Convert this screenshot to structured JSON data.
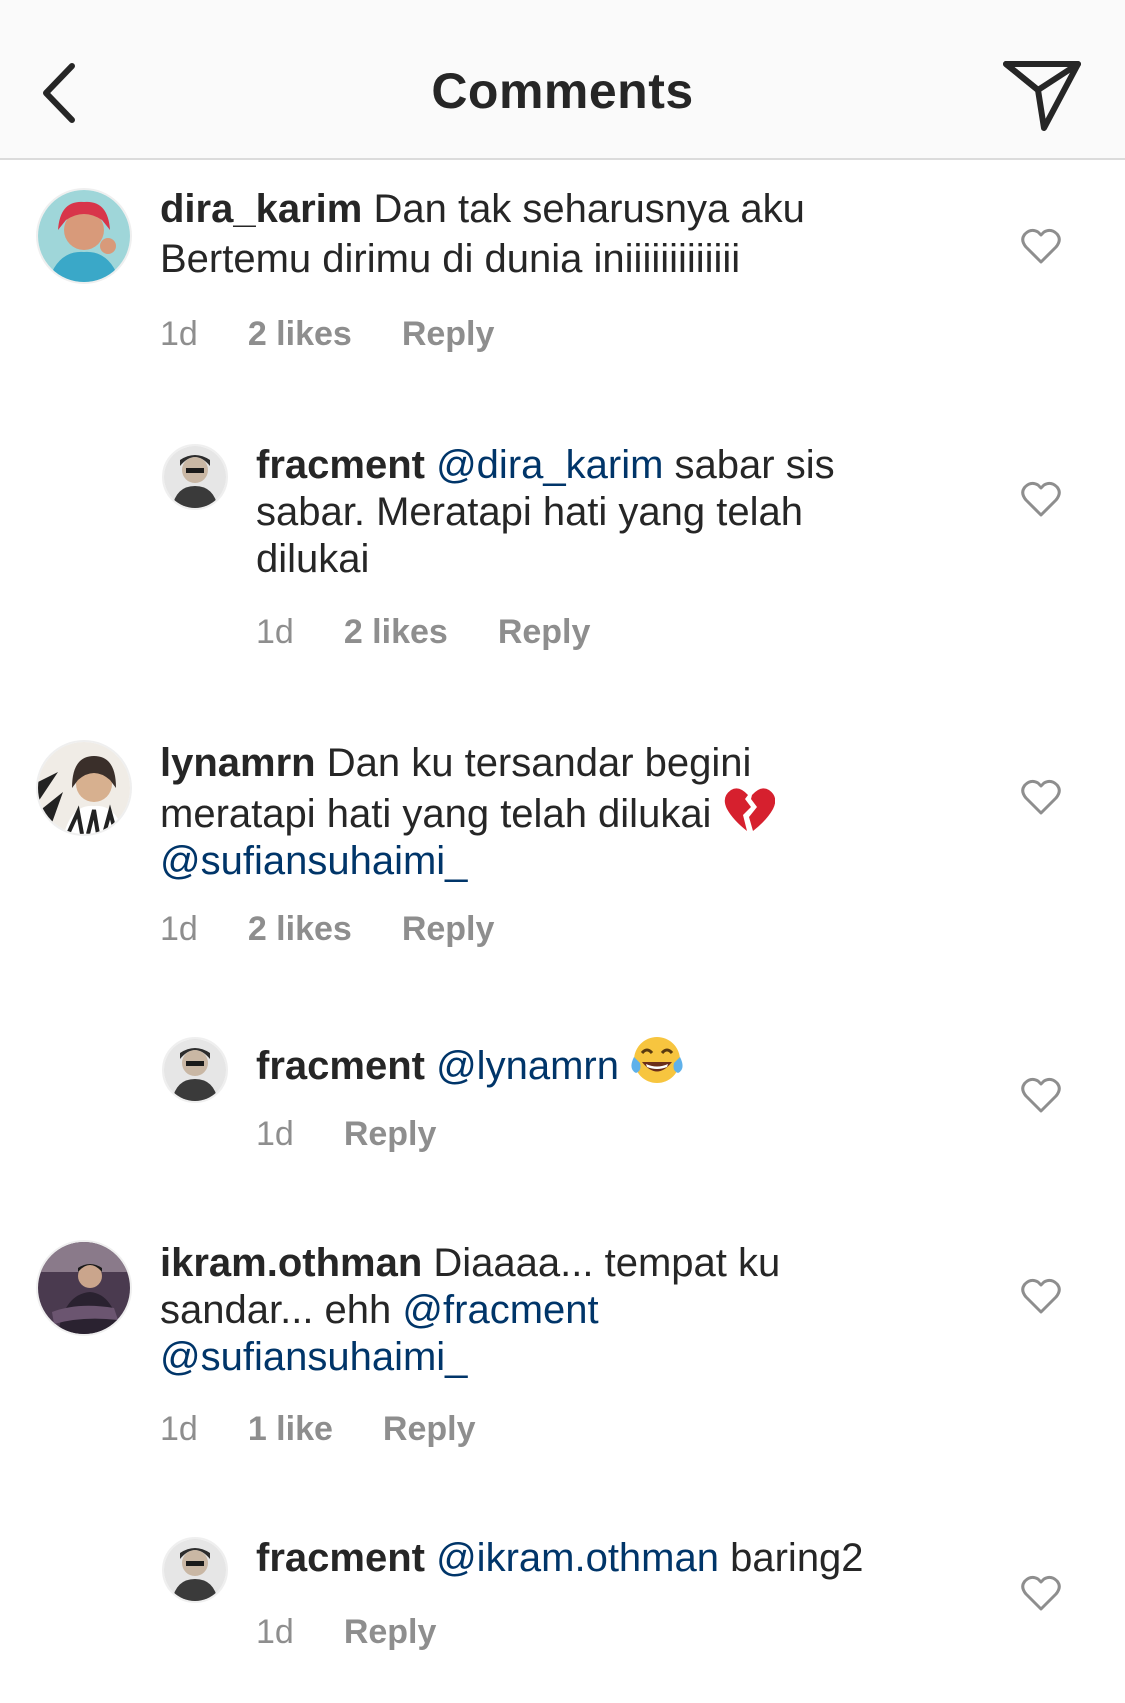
{
  "header": {
    "title": "Comments",
    "back_icon": "chevron-left-icon",
    "send_icon": "send-icon"
  },
  "comments": [
    {
      "username": "dira_karim",
      "text": " Dan tak seharusnya aku",
      "text2": "Bertemu dirimu di dunia iniiiiiiiiiiiii",
      "time": "1d",
      "likes": "2 likes",
      "reply": "Reply"
    },
    {
      "username": "fracment",
      "mention": "@dira_karim",
      "text": " sabar sis",
      "text2": "sabar. Meratapi hati yang telah",
      "text3": "dilukai",
      "time": "1d",
      "likes": "2 likes",
      "reply": "Reply"
    },
    {
      "username": "lynamrn",
      "text": " Dan ku tersandar begini",
      "text2": "meratapi hati yang telah dilukai",
      "emoji": "broken-heart-icon",
      "mention": "@sufiansuhaimi_",
      "time": "1d",
      "likes": "2 likes",
      "reply": "Reply"
    },
    {
      "username": "fracment",
      "mention": "@lynamrn",
      "emoji": "tears-of-joy-icon",
      "time": "1d",
      "reply": "Reply"
    },
    {
      "username": "ikram.othman",
      "text": " Diaaaa... tempat ku",
      "text2": "sandar... ehh ",
      "mention": "@fracment",
      "mention2": "@sufiansuhaimi_",
      "time": "1d",
      "likes": "1 like",
      "reply": "Reply"
    },
    {
      "username": "fracment",
      "mention": "@ikram.othman",
      "text": " baring2",
      "time": "1d",
      "reply": "Reply"
    }
  ],
  "colors": {
    "mention": "#003569",
    "meta": "#8e8e8e",
    "text": "#262626",
    "header_bg": "#fafafa"
  }
}
